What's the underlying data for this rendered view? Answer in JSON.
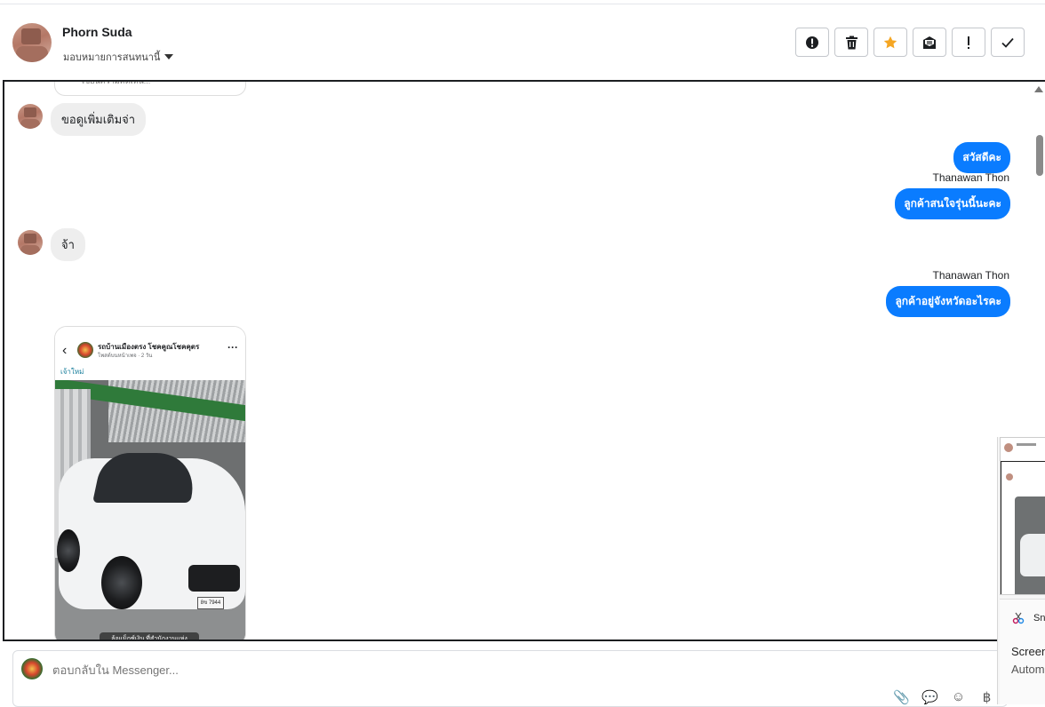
{
  "header": {
    "contact_name": "Phorn Suda",
    "assign_label": "มอบหมายการสนทนานี้",
    "actions": [
      {
        "name": "spam-icon"
      },
      {
        "name": "trash-icon"
      },
      {
        "name": "star-icon"
      },
      {
        "name": "mark-unread-icon"
      },
      {
        "name": "exclamation-icon"
      },
      {
        "name": "checkmark-icon"
      }
    ],
    "colors": {
      "star": "#f5a623",
      "accent": "#0a7cff"
    }
  },
  "conversation": {
    "previous_card_placeholder": "เขียนความคิดเห็น...",
    "messages": [
      {
        "direction": "in",
        "text": "ขอดูเพิ่มเติมจ่า"
      },
      {
        "direction": "out",
        "text": "สวัสดีคะ"
      },
      {
        "direction": "out",
        "sender": "Thanawan Thon",
        "text": "ลูกค้าสนใจรุ่นนี้นะคะ"
      },
      {
        "direction": "in",
        "text": "จ้า"
      },
      {
        "direction": "out",
        "sender": "Thanawan Thon",
        "text": "ลูกค้าอยู่จังหวัดอะไรคะ"
      }
    ],
    "shared_post": {
      "page_name": "รถบ้านเมืองตรง โชคคูณโชคคุตร",
      "page_sub": "โพสต์บนหน้าเพจ · 2 วัน",
      "link_text": "เจ้าใหม่",
      "plate": "8ข 7944",
      "caption": "ล้อแม็กซ์เงิน ที่สำนักงานแห่ง"
    }
  },
  "overlay": {
    "app_label": "Sn",
    "title": "Screen",
    "subtitle": "Autom"
  },
  "composer": {
    "placeholder": "ตอบกลับใน Messenger...",
    "tools": [
      {
        "name": "attachment-icon",
        "glyph": "📎"
      },
      {
        "name": "saved-replies-icon",
        "glyph": "💬"
      },
      {
        "name": "emoji-icon",
        "glyph": "☺"
      },
      {
        "name": "baht-icon",
        "glyph": "฿"
      }
    ]
  }
}
